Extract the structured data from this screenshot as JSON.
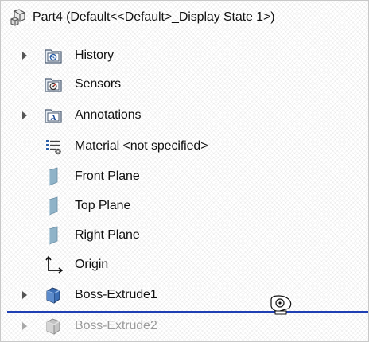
{
  "tree": {
    "root": {
      "label": "Part4  (Default<<Default>_Display State 1>)",
      "icon": "part-icon"
    },
    "items": [
      {
        "label": "History",
        "icon": "history-folder-icon",
        "expandable": true,
        "disabled": false
      },
      {
        "label": "Sensors",
        "icon": "sensors-folder-icon",
        "expandable": false,
        "disabled": false
      },
      {
        "label": "Annotations",
        "icon": "annotations-folder-icon",
        "expandable": true,
        "disabled": false
      },
      {
        "label": "Material <not specified>",
        "icon": "material-icon",
        "expandable": false,
        "disabled": false
      },
      {
        "label": "Front Plane",
        "icon": "plane-icon",
        "expandable": false,
        "disabled": false
      },
      {
        "label": "Top Plane",
        "icon": "plane-icon",
        "expandable": false,
        "disabled": false
      },
      {
        "label": "Right Plane",
        "icon": "plane-icon",
        "expandable": false,
        "disabled": false
      },
      {
        "label": "Origin",
        "icon": "origin-icon",
        "expandable": false,
        "disabled": false
      },
      {
        "label": "Boss-Extrude1",
        "icon": "extrude-icon",
        "expandable": true,
        "disabled": false
      },
      {
        "label": "Boss-Extrude2",
        "icon": "extrude-icon",
        "expandable": true,
        "disabled": true
      }
    ]
  },
  "colors": {
    "insertion_line": "#1f3fb3",
    "disabled_text": "#9a9a9a",
    "plane_fill": "#8fb3c8"
  },
  "cursor": {
    "icon": "drag-move-cursor-icon"
  }
}
